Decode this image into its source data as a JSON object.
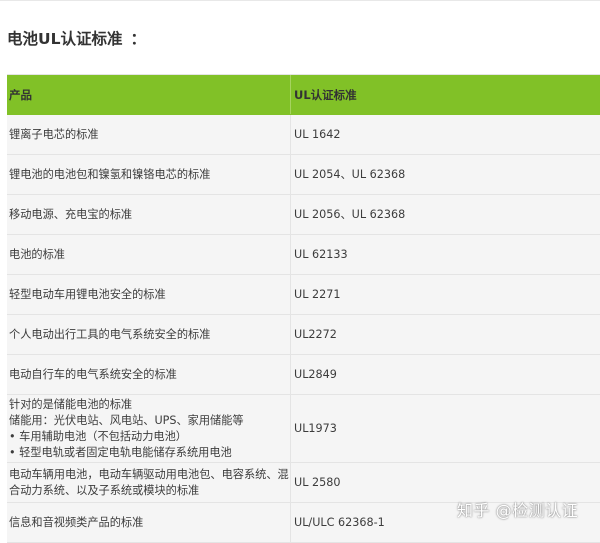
{
  "heading": {
    "title": "电池UL认证标准",
    "colon": "："
  },
  "table": {
    "headers": {
      "product": "产品",
      "standard": "UL认证标准"
    },
    "rows": [
      {
        "product": [
          "锂离子电芯的标准"
        ],
        "standard": "UL 1642"
      },
      {
        "product": [
          "锂电池的电池包和镍氢和镍铬电芯的标准"
        ],
        "standard": "UL 2054、UL 62368"
      },
      {
        "product": [
          "移动电源、充电宝的标准"
        ],
        "standard": "UL 2056、UL 62368"
      },
      {
        "product": [
          "电池的标准"
        ],
        "standard": "UL 62133"
      },
      {
        "product": [
          "轻型电动车用锂电池安全的标准"
        ],
        "standard": "UL 2271"
      },
      {
        "product": [
          "个人电动出行工具的电气系统安全的标准"
        ],
        "standard": "UL2272"
      },
      {
        "product": [
          "电动自行车的电气系统安全的标准"
        ],
        "standard": "UL2849"
      },
      {
        "product": [
          "针对的是储能电池的标准",
          "储能用：光伏电站、风电站、UPS、家用储能等",
          "• 车用辅助电池（不包括动力电池）",
          "• 轻型电轨或者固定电轨电能储存系统用电池"
        ],
        "standard": "UL1973"
      },
      {
        "product": [
          "电动车辆用电池，电动车辆驱动用电池包、电容系统、混",
          "合动力系统、以及子系统或模块的标准"
        ],
        "standard": "UL 2580"
      },
      {
        "product": [
          "信息和音视频类产品的标准"
        ],
        "standard": "UL/ULC 62368-1"
      }
    ]
  },
  "watermark": {
    "text": "知乎 @检测认证"
  },
  "colors": {
    "header_green": "#81c127",
    "row_background": "#f5f5f5",
    "border": "#e4e4e4",
    "text": "#333333"
  }
}
